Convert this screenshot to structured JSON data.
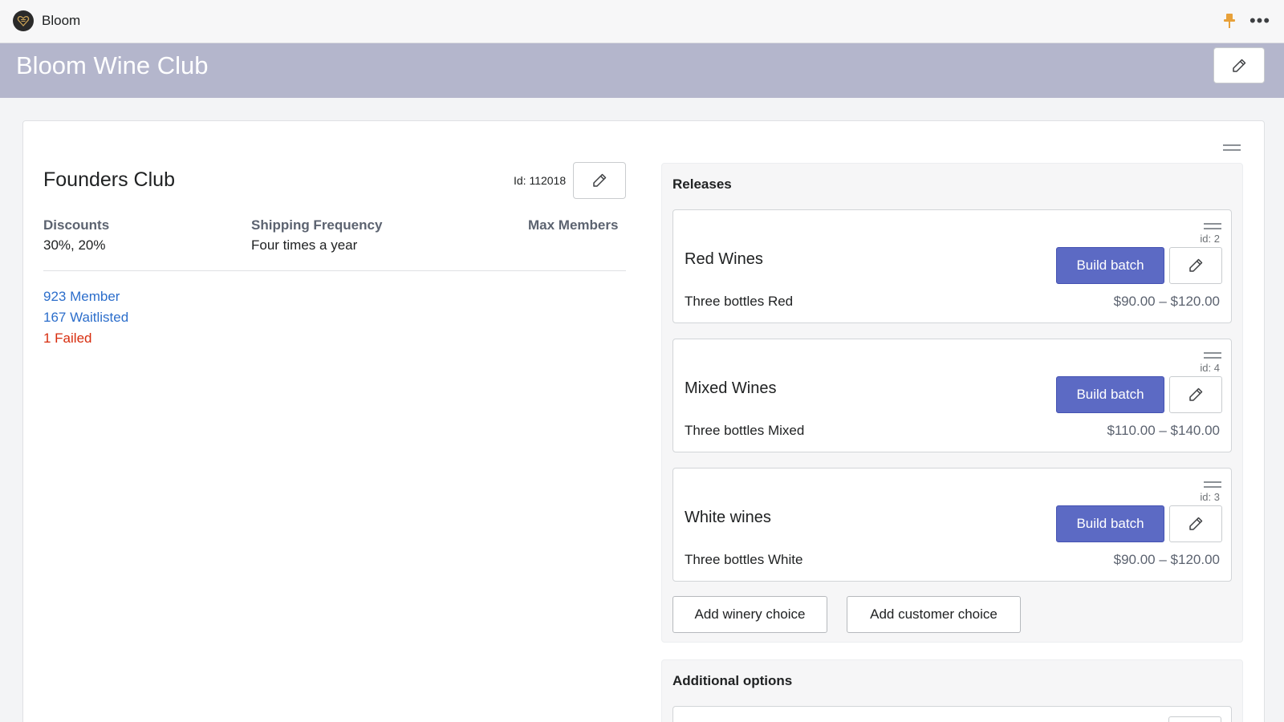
{
  "app": {
    "name": "Bloom"
  },
  "header": {
    "title": "Bloom Wine Club"
  },
  "club": {
    "name": "Founders Club",
    "id_label": "Id: 112018",
    "discounts_label": "Discounts",
    "discounts_value": "30%, 20%",
    "shipping_label": "Shipping Frequency",
    "shipping_value": "Four times a year",
    "max_label": "Max Members",
    "stats": {
      "members": "923 Member",
      "waitlisted": "167 Waitlisted",
      "failed": "1 Failed"
    }
  },
  "releases": {
    "title": "Releases",
    "items": [
      {
        "id_label": "id: 2",
        "name": "Red Wines",
        "description": "Three bottles Red",
        "price": "$90.00 – $120.00",
        "build_label": "Build batch"
      },
      {
        "id_label": "id: 4",
        "name": "Mixed Wines",
        "description": "Three bottles Mixed",
        "price": "$110.00 – $140.00",
        "build_label": "Build batch"
      },
      {
        "id_label": "id: 3",
        "name": "White wines",
        "description": "Three bottles White",
        "price": "$90.00 – $120.00",
        "build_label": "Build batch"
      }
    ],
    "add_winery_label": "Add winery choice",
    "add_customer_label": "Add customer choice"
  },
  "additional": {
    "title": "Additional options"
  },
  "icons": {
    "logo": "bloom-heart-logo",
    "pin": "pin-icon",
    "more": "more-horizontal-icon",
    "edit": "pencil-icon",
    "drag": "drag-handle-icon"
  },
  "colors": {
    "header_bg": "#b4b6cc",
    "primary_button": "#5c6ac4",
    "link": "#2c6ecb",
    "error": "#d72c0d",
    "pin": "#e8a13a"
  }
}
